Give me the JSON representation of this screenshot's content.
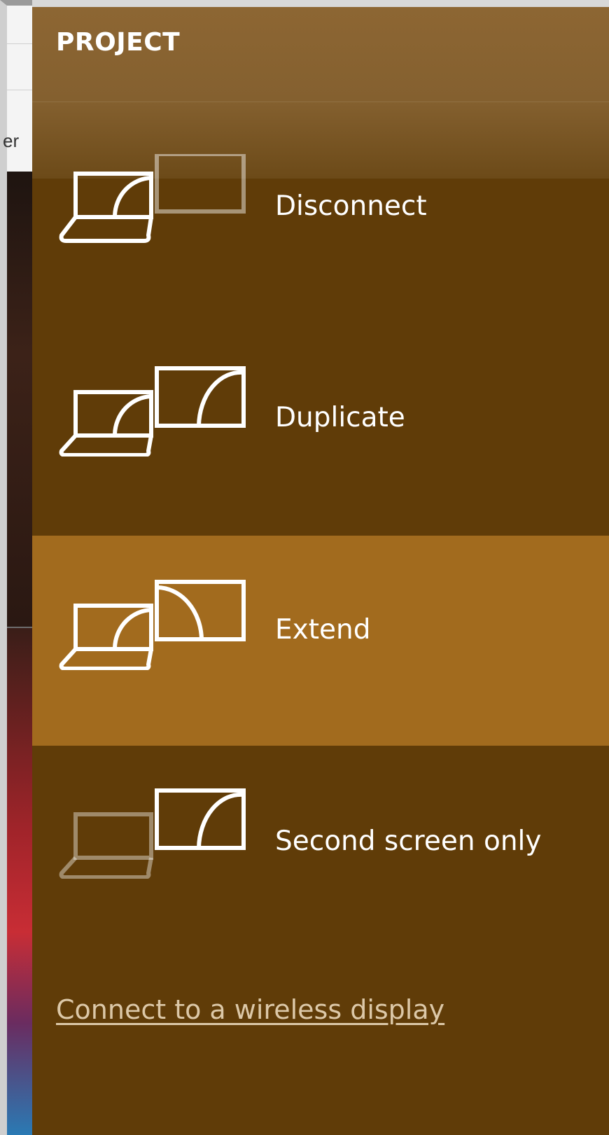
{
  "background_window": {
    "partial_text": "er"
  },
  "flyout": {
    "title": "PROJECT",
    "options": [
      {
        "label": "Disconnect",
        "icon": "disconnect-icon",
        "selected": false
      },
      {
        "label": "Duplicate",
        "icon": "duplicate-icon",
        "selected": false
      },
      {
        "label": "Extend",
        "icon": "extend-icon",
        "selected": true
      },
      {
        "label": "Second screen only",
        "icon": "second-screen-only-icon",
        "selected": false
      }
    ],
    "wireless_link": "Connect to a wireless display"
  },
  "colors": {
    "panel_background": "#603c08",
    "header_background": "#8d6633",
    "selected_background": "#a26b1e",
    "text": "#ffffff",
    "link_text": "#dcc8a8"
  }
}
